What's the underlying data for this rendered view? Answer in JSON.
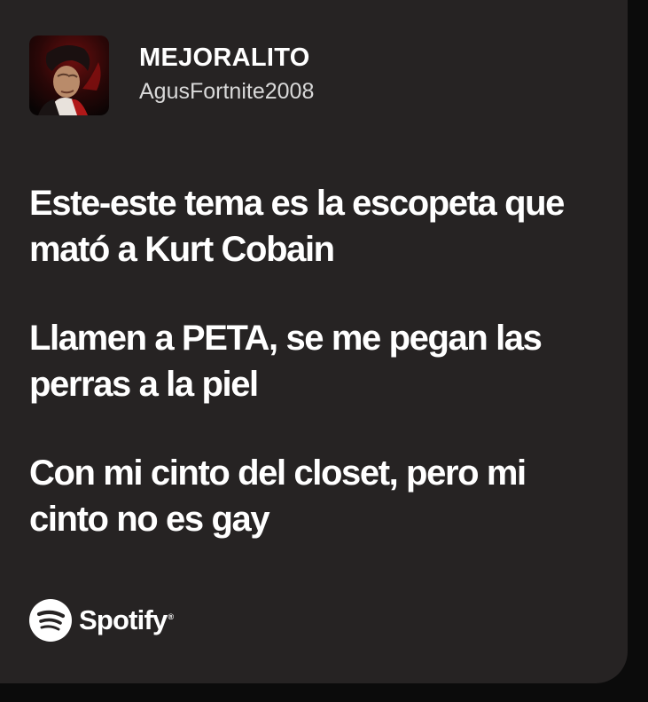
{
  "song": {
    "title": "MEJORALITO",
    "artist": "AgusFortnite2008"
  },
  "cover": {
    "icon": "album-cover-beethoven-portrait"
  },
  "lyrics": [
    "Este-este tema es la escopeta que mató a Kurt Cobain",
    "Llamen a PETA, se me pegan las perras a la piel",
    "Con mi cinto del closet, pero mi cinto no es gay"
  ],
  "footer": {
    "brand": "Spotify",
    "icon": "spotify-logo-icon"
  },
  "colors": {
    "card_background": "#262323",
    "page_background": "#0b0b0b",
    "text": "#ffffff"
  }
}
